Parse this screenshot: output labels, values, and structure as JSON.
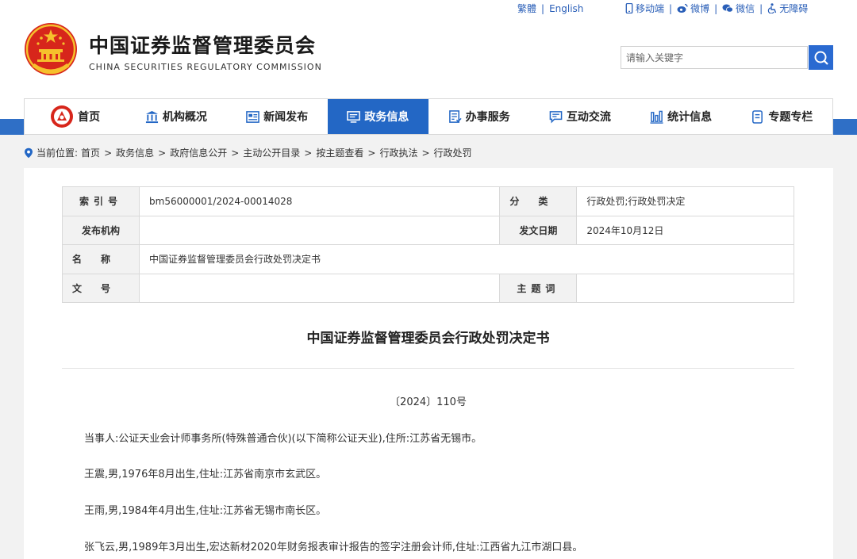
{
  "topbar": {
    "traditional": "繁體",
    "english": "English",
    "mobile": "移动端",
    "weibo": "微博",
    "wechat": "微信",
    "accessibility": "无障碍"
  },
  "header": {
    "title": "中国证券监督管理委员会",
    "subtitle": "CHINA SECURITIES REGULATORY COMMISSION"
  },
  "search": {
    "placeholder": "请输入关键字"
  },
  "nav": {
    "items": [
      "首页",
      "机构概况",
      "新闻发布",
      "政务信息",
      "办事服务",
      "互动交流",
      "统计信息",
      "专题专栏"
    ],
    "active_index": 3
  },
  "breadcrumb": {
    "prefix": "当前位置:",
    "items": [
      "首页",
      "政务信息",
      "政府信息公开",
      "主动公开目录",
      "按主题查看",
      "行政执法",
      "行政处罚"
    ]
  },
  "meta": {
    "index_label": "索引号",
    "index_value": "bm56000001/2024-00014028",
    "category_label": "分类",
    "category_value": "行政处罚;行政处罚决定",
    "publisher_label": "发布机构",
    "publisher_value": "",
    "date_label": "发文日期",
    "date_value": "2024年10月12日",
    "name_label": "名称",
    "name_value": "中国证券监督管理委员会行政处罚决定书",
    "docno_label": "文号",
    "docno_value": "",
    "keywords_label": "主题词",
    "keywords_value": ""
  },
  "document": {
    "title": "中国证券监督管理委员会行政处罚决定书",
    "number": "〔2024〕110号",
    "paragraphs": [
      "当事人:公证天业会计师事务所(特殊普通合伙)(以下简称公证天业),住所:江苏省无锡市。",
      "王震,男,1976年8月出生,住址:江苏省南京市玄武区。",
      "王雨,男,1984年4月出生,住址:江苏省无锡市南长区。",
      "张飞云,男,1989年3月出生,宏达新材2020年财务报表审计报告的签字注册会计师,住址:江西省九江市湖口县。"
    ]
  },
  "colors": {
    "brand_blue": "#2367c5",
    "accent_red": "#d7261b"
  }
}
